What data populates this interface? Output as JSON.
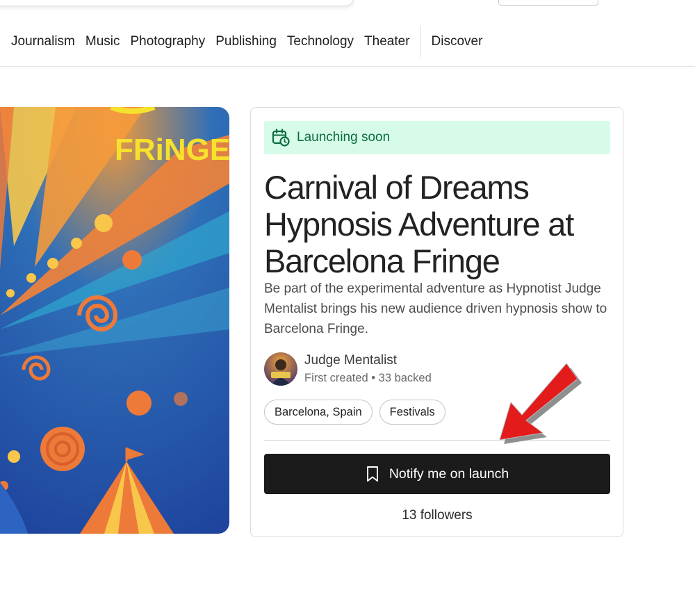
{
  "nav": {
    "items": [
      "Journalism",
      "Music",
      "Photography",
      "Publishing",
      "Technology",
      "Theater"
    ],
    "discover": "Discover"
  },
  "hero": {
    "poster_word": "FRiNGE",
    "image": "carnival-poster-image"
  },
  "card": {
    "badge": "Launching soon",
    "title": "Carnival of Dreams Hypnosis Adventure at Barcelona Fringe",
    "blurb": "Be part of the experimental adventure as Hypnotist Judge Mentalist brings his new audience driven hypnosis show to Barcelona Fringe.",
    "creator": {
      "name": "Judge Mentalist",
      "meta": "First created • 33 backed"
    },
    "tags": [
      "Barcelona, Spain",
      "Festivals"
    ],
    "notify_label": "Notify me on launch",
    "followers": "13 followers"
  },
  "colors": {
    "badge_bg": "#d6fbe8",
    "badge_text": "#0b6b3e",
    "button_bg": "#1b1b1b",
    "arrow": "#e31b1b"
  },
  "icons": {
    "badge": "calendar-clock-icon",
    "notify": "bookmark-icon",
    "annotation": "red-arrow-icon"
  }
}
